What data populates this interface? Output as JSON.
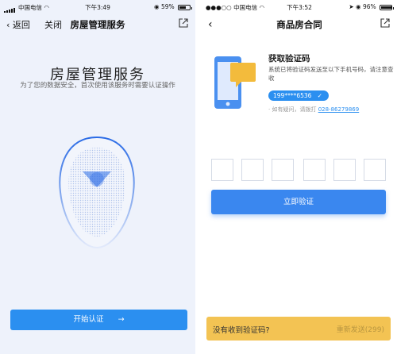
{
  "left_screen": {
    "status_bar": {
      "carrier": "中国电信",
      "time": "下午3:49",
      "battery": "59%",
      "battery_level": 0.59
    },
    "nav": {
      "back_label": "返回",
      "close_label": "关闭",
      "title": "房屋管理服务"
    },
    "heading": "房屋管理服务",
    "description": "为了您的数据安全，首次使用该服务时需要认证操作",
    "start_button": {
      "label": "开始认证",
      "arrow": "→"
    }
  },
  "right_screen": {
    "status_bar": {
      "carrier": "中国电信",
      "time": "下午3:52",
      "battery": "96%",
      "battery_level": 0.96
    },
    "nav": {
      "title": "商品房合同"
    },
    "verification": {
      "title": "获取验证码",
      "description": "系统已将验证码发送至以下手机号码，请注意查收",
      "phone_number": "199****6536",
      "help_prefix": "· 如有疑问，请拨打",
      "help_phone": "028-86279869"
    },
    "code_boxes": [
      "",
      "",
      "",
      "",
      "",
      ""
    ],
    "verify_button": "立即验证",
    "bottom_bar": {
      "no_code_text": "没有收到验证码?",
      "resend_text": "重新发送(299)"
    }
  },
  "colors": {
    "accent": "#2b8ff0",
    "warning_bar": "#f3c353",
    "left_background": "#eef2fb"
  }
}
